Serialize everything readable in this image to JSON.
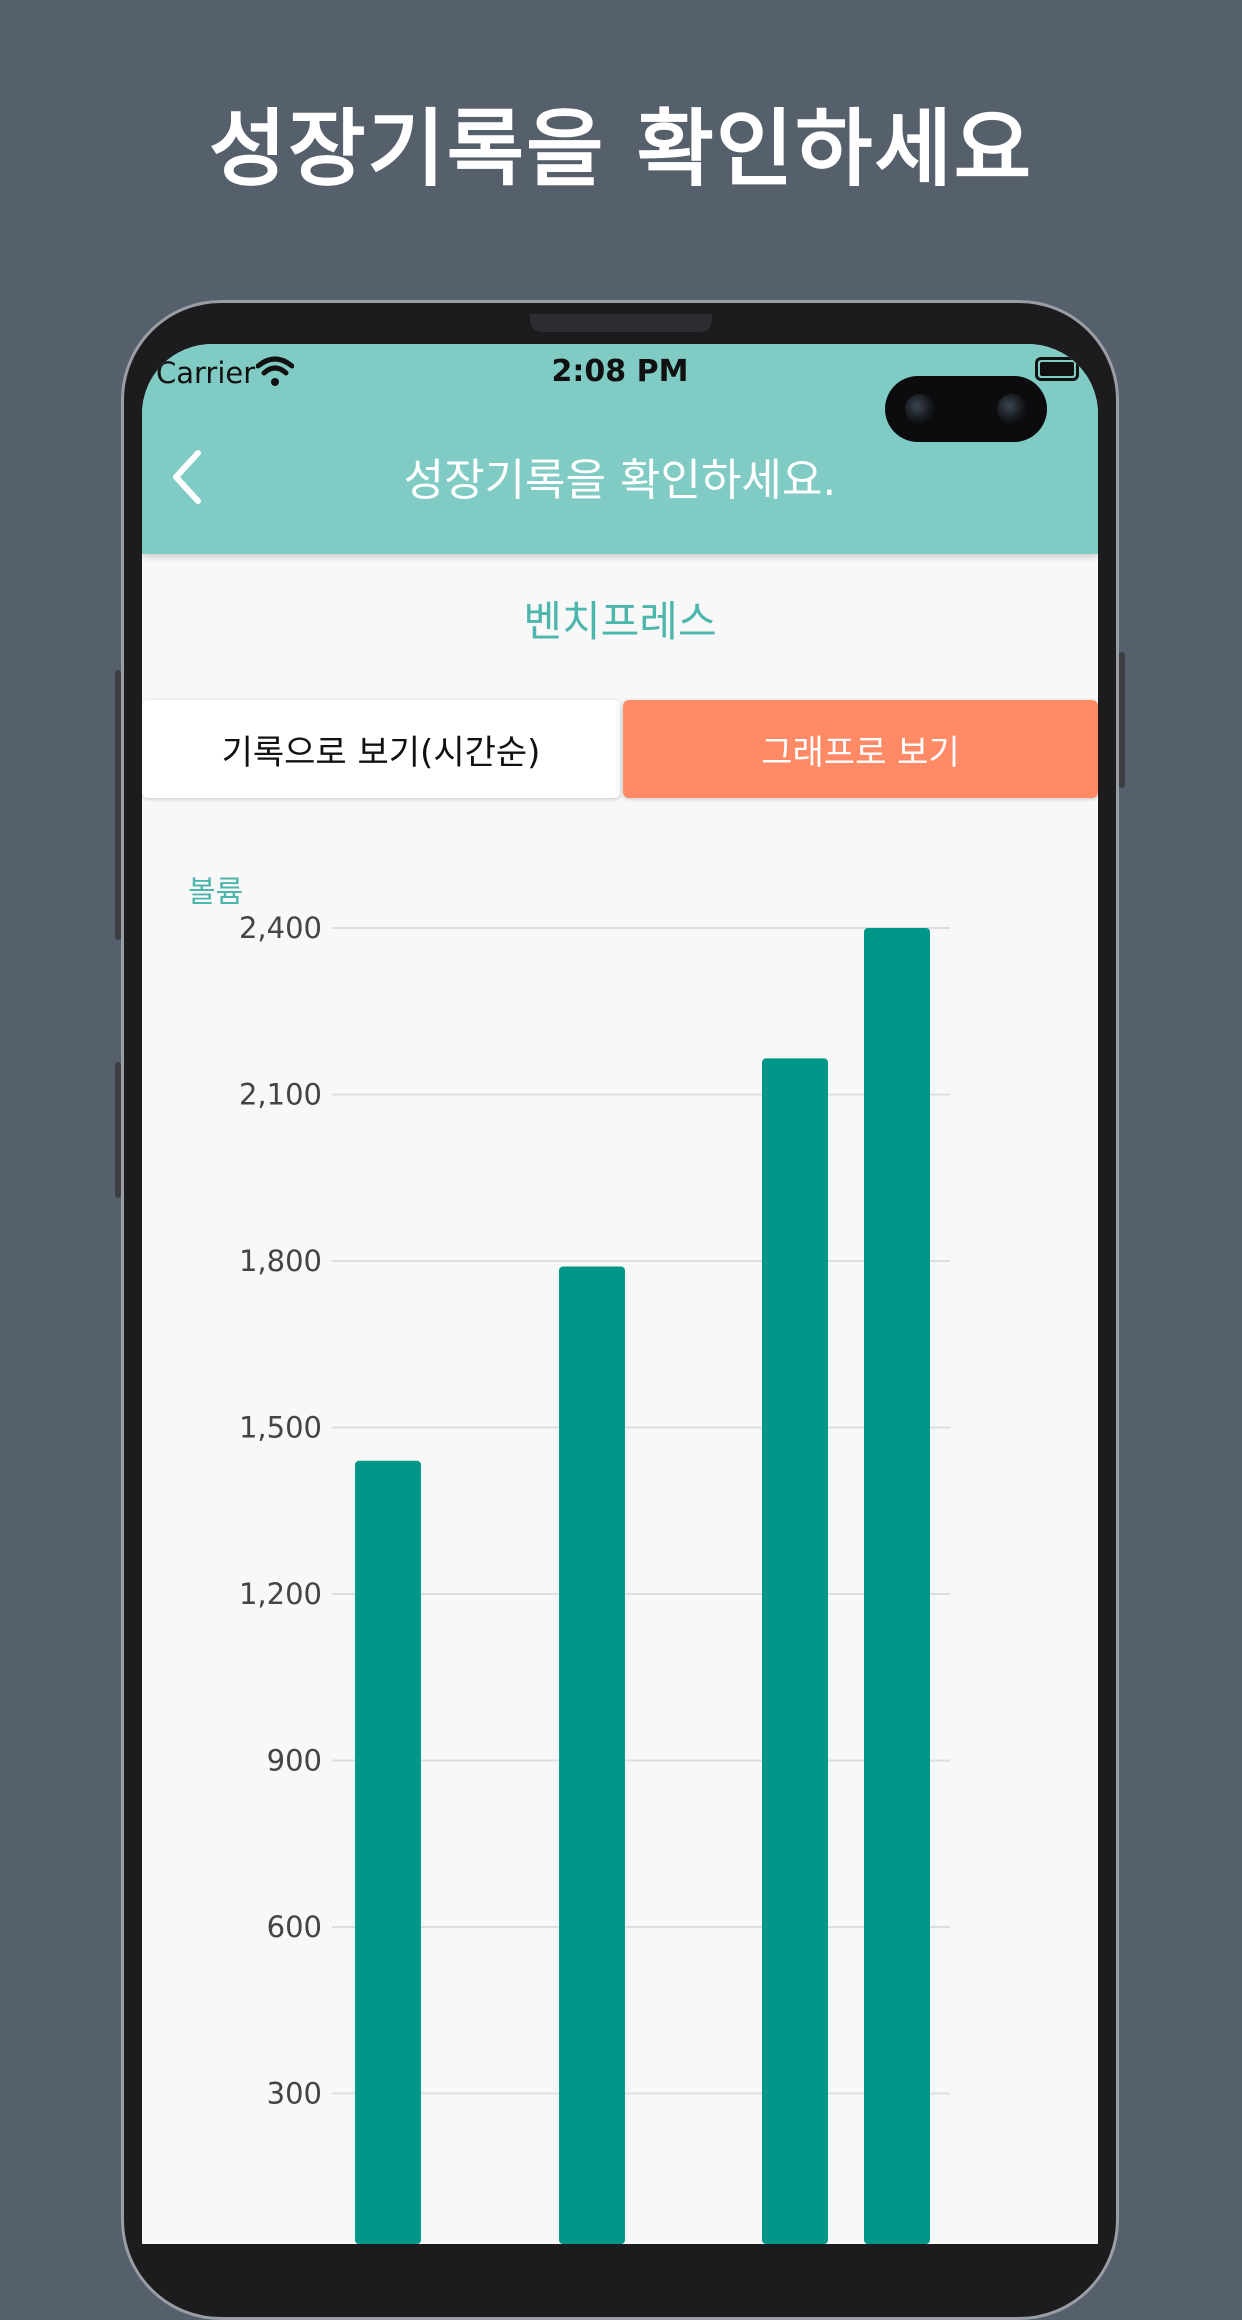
{
  "promo_title": "성장기록을 확인하세요",
  "status_bar": {
    "carrier": "Carrier",
    "time": "2:08 PM"
  },
  "app_bar": {
    "title": "성장기록을 확인하세요."
  },
  "exercise_name": "벤치프레스",
  "tabs": {
    "list_label": "기록으로 보기(시간순)",
    "graph_label": "그래프로 보기"
  },
  "colors": {
    "background": "#56606d",
    "app_bar": "#80cbc4",
    "accent_teal": "#4db6ac",
    "active_tab": "#ff8a65",
    "bar": "#009688"
  },
  "chart_data": {
    "type": "bar",
    "ylabel": "볼륨",
    "yticks": [
      "2,400",
      "2,100",
      "1,800",
      "1,500",
      "1,200",
      "900",
      "600",
      "300"
    ],
    "ylim": [
      0,
      2400
    ],
    "values": [
      1440,
      1790,
      2165,
      2400
    ],
    "grid": true
  }
}
